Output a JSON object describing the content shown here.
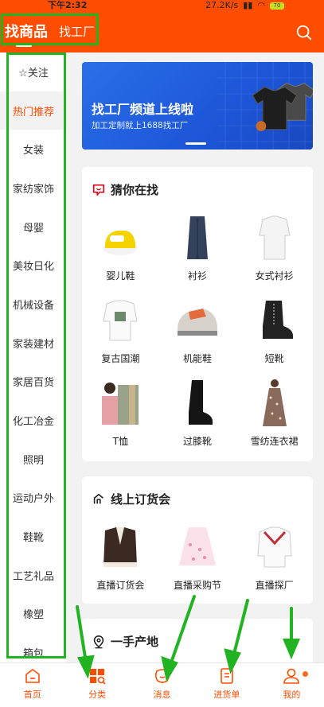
{
  "status_bar": {
    "time": "下午2:32",
    "speed": "27.2K/s",
    "battery": "70"
  },
  "header": {
    "tab_active": "找商品",
    "tab_other": "找工厂",
    "search_icon": "search-icon"
  },
  "sidebar": {
    "items": [
      {
        "label": "☆关注",
        "active": false
      },
      {
        "label": "热门推荐",
        "active": true
      },
      {
        "label": "女装",
        "active": false
      },
      {
        "label": "家纺家饰",
        "active": false
      },
      {
        "label": "母婴",
        "active": false
      },
      {
        "label": "美妆日化",
        "active": false
      },
      {
        "label": "机械设备",
        "active": false
      },
      {
        "label": "家装建材",
        "active": false
      },
      {
        "label": "家居百货",
        "active": false
      },
      {
        "label": "化工冶金",
        "active": false
      },
      {
        "label": "照明",
        "active": false
      },
      {
        "label": "运动户外",
        "active": false
      },
      {
        "label": "鞋靴",
        "active": false
      },
      {
        "label": "工艺礼品",
        "active": false
      },
      {
        "label": "橡塑",
        "active": false
      },
      {
        "label": "箱包",
        "active": false
      }
    ]
  },
  "banner": {
    "title": "找工厂频道上线啦",
    "subtitle": "加工定制就上1688找工厂"
  },
  "guess": {
    "title": "猜你在找",
    "items": [
      "婴儿鞋",
      "衬衫",
      "女式衬衫",
      "复古国潮",
      "机能鞋",
      "短靴",
      "T恤",
      "过膝靴",
      "雪纺连衣裙"
    ]
  },
  "order_fair": {
    "title": "线上订货会",
    "items": [
      "直播订货会",
      "直播采购节",
      "直播探厂"
    ]
  },
  "origin": {
    "title": "一手产地"
  },
  "bottom_nav": [
    {
      "label": "首页",
      "icon": "home-icon"
    },
    {
      "label": "分类",
      "icon": "category-icon"
    },
    {
      "label": "消息",
      "icon": "message-icon"
    },
    {
      "label": "进货单",
      "icon": "order-list-icon"
    },
    {
      "label": "我的",
      "icon": "profile-icon"
    }
  ],
  "colors": {
    "brand": "#ff4d00",
    "annotation": "#22b322"
  }
}
